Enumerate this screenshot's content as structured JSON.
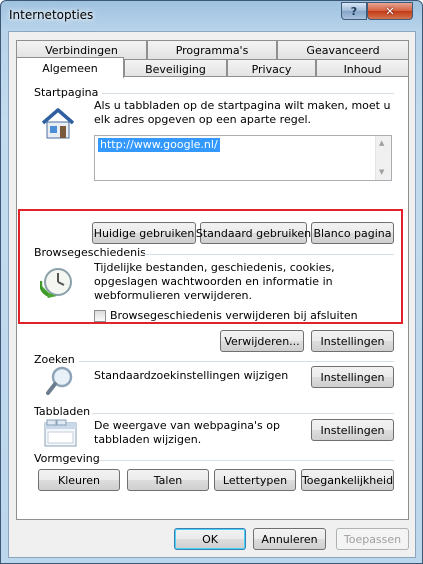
{
  "window": {
    "title": "Internetopties",
    "help_label": "?",
    "close_label": "✕"
  },
  "tabs": {
    "row1": [
      "Verbindingen",
      "Programma's",
      "Geavanceerd"
    ],
    "row2": [
      "Algemeen",
      "Beveiliging",
      "Privacy",
      "Inhoud"
    ],
    "active": "Algemeen"
  },
  "startpagina": {
    "title": "Startpagina",
    "description": "Als u tabbladen op de startpagina wilt maken, moet u elk adres opgeven op een aparte regel.",
    "url": "http://www.google.nl/",
    "buttons": {
      "current": "Huidige gebruiken",
      "default": "Standaard gebruiken",
      "blank": "Blanco pagina"
    },
    "icon": "house-icon"
  },
  "browsegeschiedenis": {
    "title": "Browsegeschiedenis",
    "description": "Tijdelijke bestanden, geschiedenis, cookies, opgeslagen wachtwoorden en informatie in webformulieren verwijderen.",
    "checkbox_label": "Browsegeschiedenis verwijderen bij afsluiten",
    "checkbox_checked": false,
    "buttons": {
      "delete": "Verwijderen...",
      "settings": "Instellingen"
    },
    "icon": "clock-icon",
    "highlight_color": "#e0222a"
  },
  "zoeken": {
    "title": "Zoeken",
    "description": "Standaardzoekinstellingen wijzigen",
    "button": "Instellingen",
    "icon": "magnifier-icon"
  },
  "tabbladen": {
    "title": "Tabbladen",
    "description": "De weergave van webpagina's op tabbladen wijzigen.",
    "button": "Instellingen",
    "icon": "tabbed-window-icon"
  },
  "vormgeving": {
    "title": "Vormgeving",
    "buttons": {
      "colors": "Kleuren",
      "languages": "Talen",
      "fonts": "Lettertypen",
      "accessibility": "Toegankelijkheid"
    }
  },
  "footer": {
    "ok": "OK",
    "cancel": "Annuleren",
    "apply": "Toepassen"
  }
}
